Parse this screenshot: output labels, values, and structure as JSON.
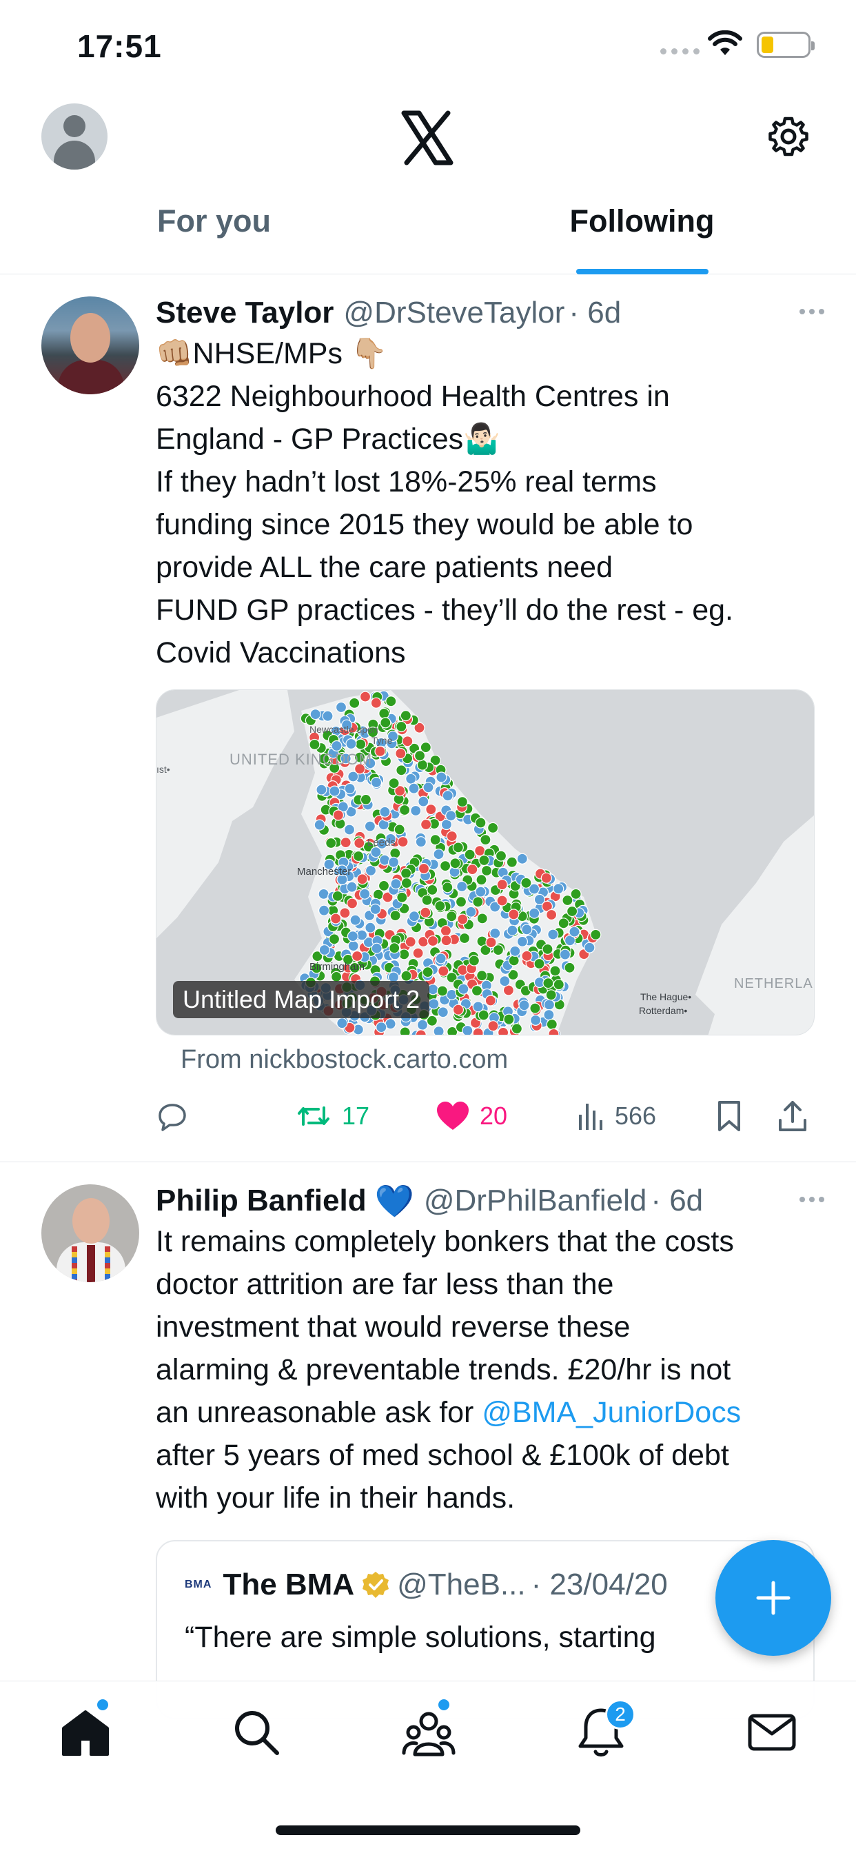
{
  "status_bar": {
    "time": "17:51",
    "battery_color": "#f5c400"
  },
  "header": {
    "logo": "X",
    "tabs": [
      {
        "label": "For you",
        "active": false
      },
      {
        "label": "Following",
        "active": true
      }
    ]
  },
  "tweets": [
    {
      "author": "Steve Taylor",
      "handle": "@DrSteveTaylor",
      "time": "· 6d",
      "lines": [
        "👊🏼NHSE/MPs 👇🏼",
        "6322 Neighbourhood Health Centres in",
        "England - GP Practices🤷🏻‍♂️",
        "If they hadn’t lost 18%-25% real terms",
        "funding since 2015 they would be able to",
        "provide ALL the care patients need",
        "FUND GP practices - they’ll do the rest - eg.",
        "Covid Vaccinations"
      ],
      "card": {
        "map_labels": {
          "newcastle": "Newcastle upon",
          "tyne": "Tyne",
          "uk": "UNITED KINGDOM",
          "leeds": "Leeds",
          "manchester": "Manchester",
          "birmingham": "Birmingham",
          "hague": "The Hague•",
          "rotterdam": "Rotterdam•",
          "netherlands": "NETHERLA",
          "edge": "ıst•"
        },
        "overlay_label": "Untitled Map Import 2",
        "source": "From nickbostock.carto.com"
      },
      "stats": {
        "replies": "",
        "retweets": "17",
        "likes": "20",
        "views": "566"
      }
    },
    {
      "author": "Philip Banfield",
      "emoji": "💙",
      "handle": "@DrPhilBanfield",
      "time": "· 6d",
      "lines": [
        "It remains completely bonkers that the costs",
        "doctor attrition are far less than the",
        "investment that would reverse these",
        "alarming & preventable trends. £20/hr is not",
        "an unreasonable ask for ",
        "after 5 years of med school & £100k of debt",
        "with your life in their hands."
      ],
      "mention": "@BMA_JuniorDocs",
      "quote": {
        "logo": "BMA",
        "name": "The BMA",
        "handle": "@TheB...",
        "time": "· 23/04/20",
        "text": "“There are simple solutions, starting"
      }
    }
  ],
  "bottom_nav": {
    "notifications_badge": "2"
  }
}
